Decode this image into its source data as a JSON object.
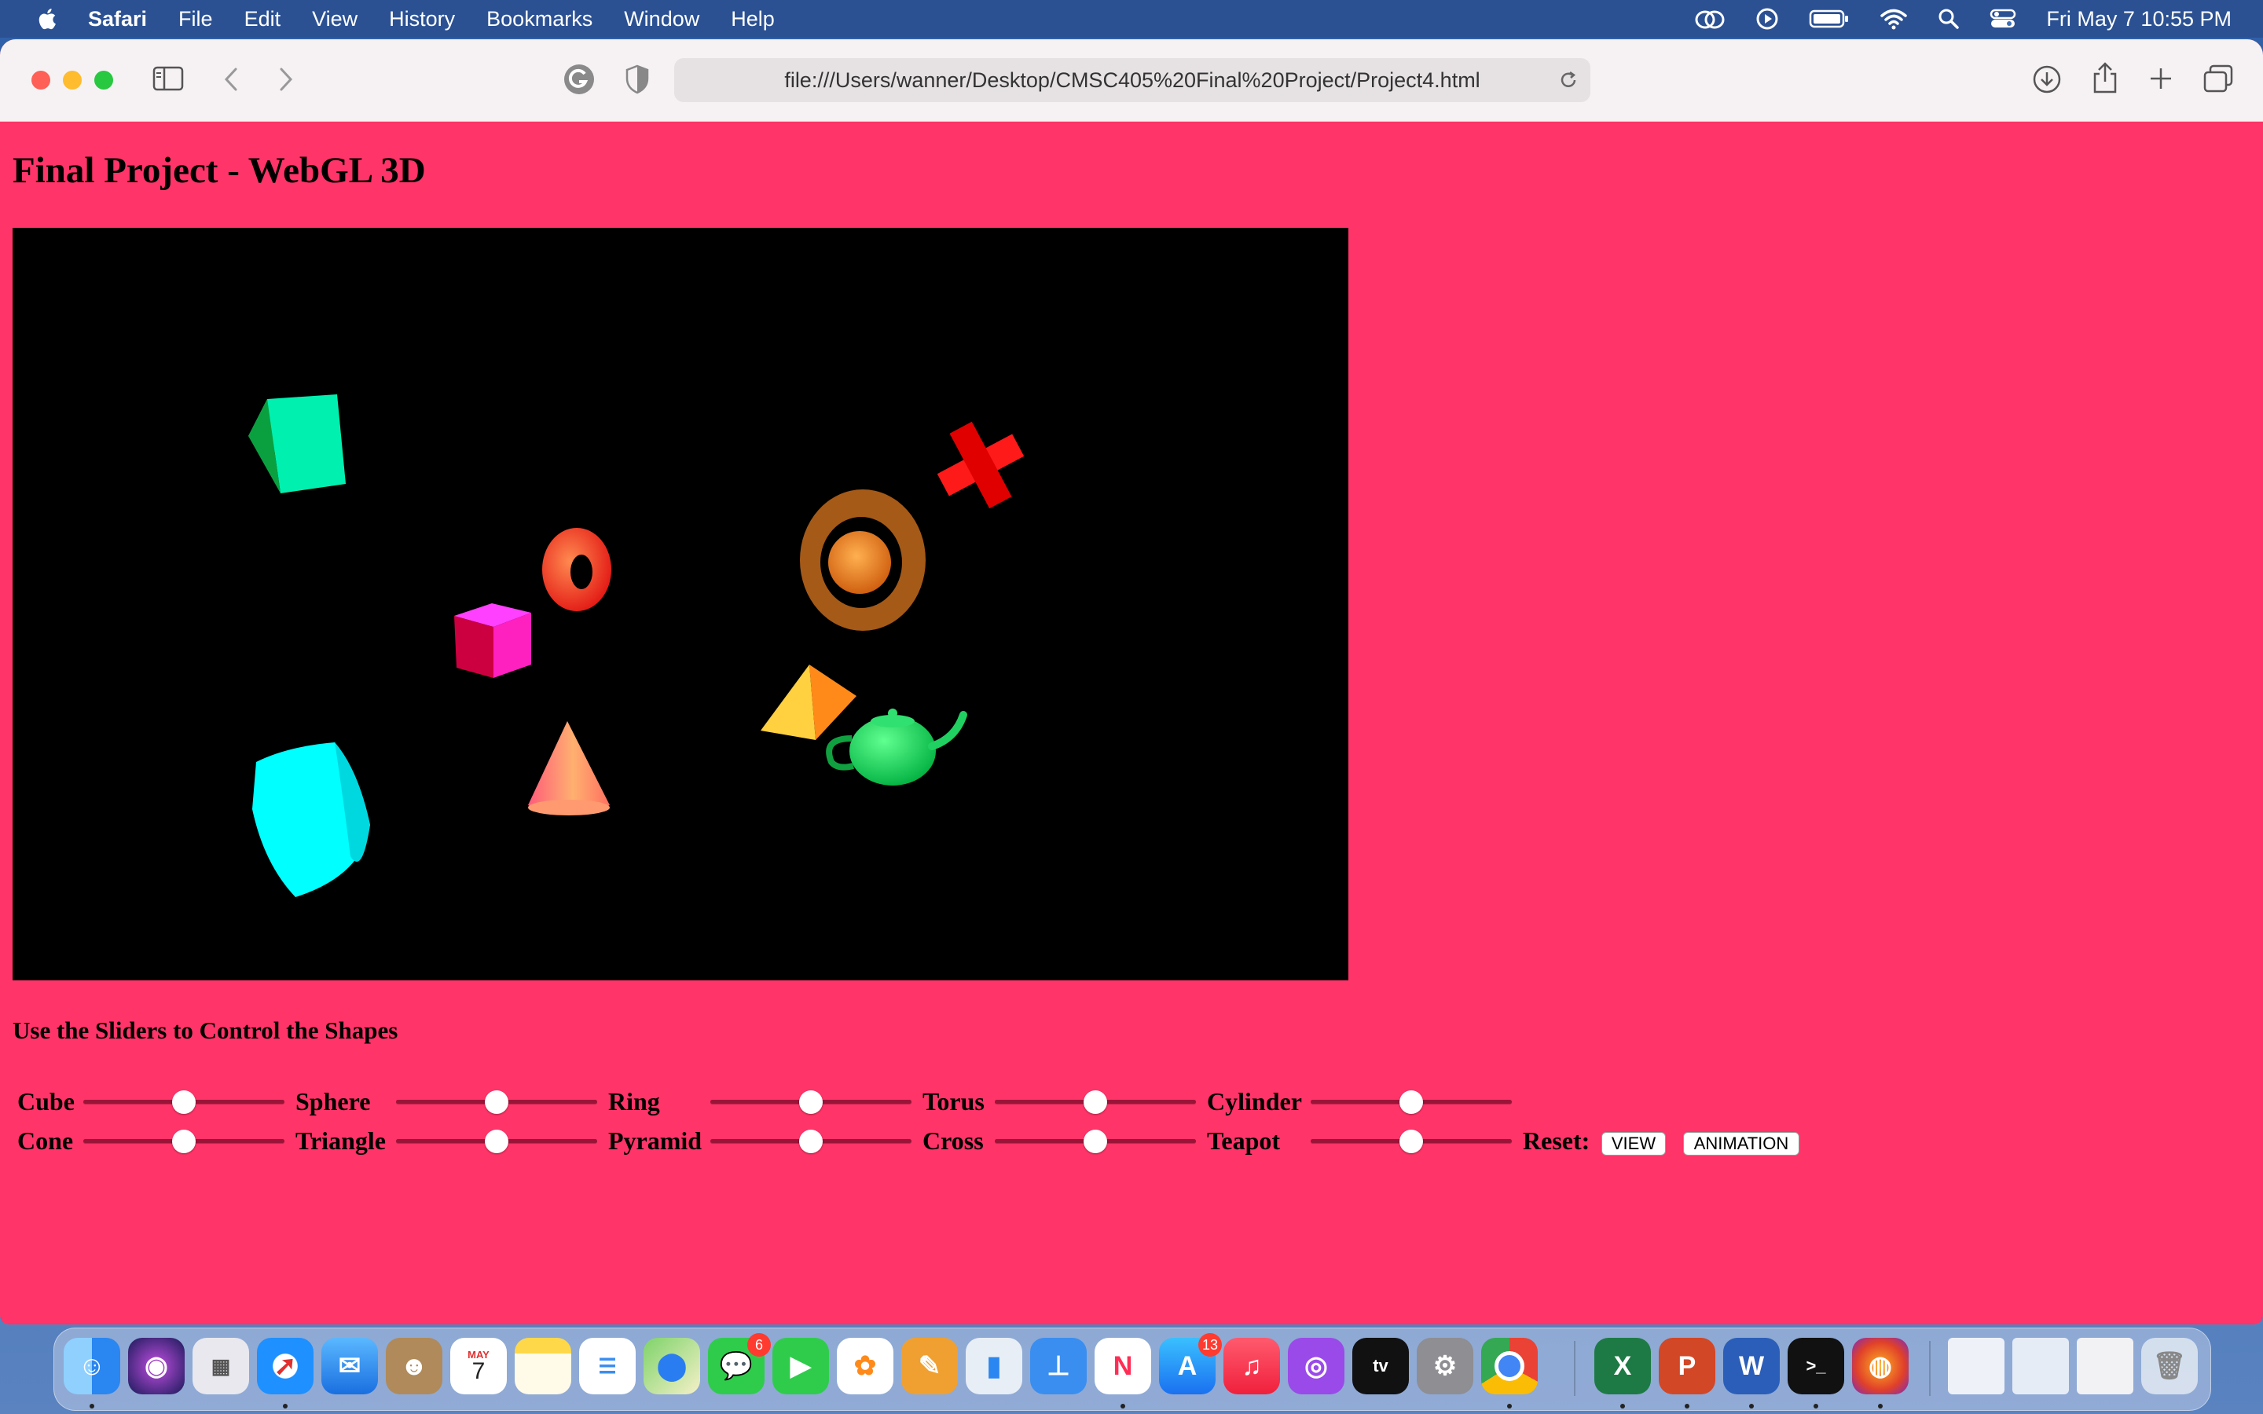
{
  "menubar": {
    "app_name": "Safari",
    "items": [
      "File",
      "Edit",
      "View",
      "History",
      "Bookmarks",
      "Window",
      "Help"
    ],
    "clock": "Fri May 7  10:55 PM"
  },
  "browser": {
    "url": "file:///Users/wanner/Desktop/CMSC405%20Final%20Project/Project4.html"
  },
  "page": {
    "title": "Final Project - WebGL 3D",
    "instructions": "Use the Sliders to Control the Shapes",
    "controls_row1": [
      {
        "label": "Cube",
        "value": 0.5
      },
      {
        "label": "Sphere",
        "value": 0.5
      },
      {
        "label": "Ring",
        "value": 0.5
      },
      {
        "label": "Torus",
        "value": 0.5
      },
      {
        "label": "Cylinder",
        "value": 0.5
      }
    ],
    "controls_row2": [
      {
        "label": "Cone",
        "value": 0.5
      },
      {
        "label": "Triangle",
        "value": 0.5
      },
      {
        "label": "Pyramid",
        "value": 0.5
      },
      {
        "label": "Cross",
        "value": 0.5
      },
      {
        "label": "Teapot",
        "value": 0.5
      }
    ],
    "reset_label": "Reset:",
    "view_button": "VIEW",
    "animation_button": "ANIMATION"
  },
  "dock": {
    "calendar_month": "MAY",
    "calendar_day": "7",
    "messages_badge": "6",
    "appstore_badge": "13"
  },
  "colors": {
    "page_background": "#ff3468",
    "canvas_background": "#000000"
  }
}
